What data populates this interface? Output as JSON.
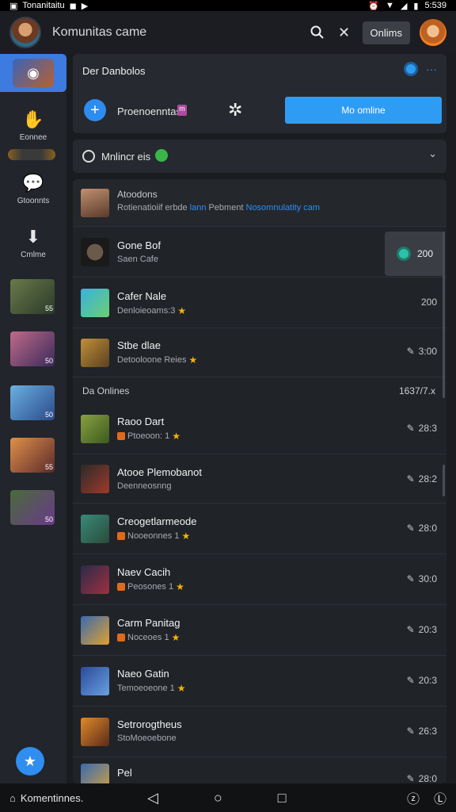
{
  "status_bar": {
    "left_text": "Tonanitaitu",
    "time": "5:539"
  },
  "app_bar": {
    "title": "Komunitas came",
    "online_button": "Onlims",
    "icons": [
      "search-icon",
      "close-icon"
    ]
  },
  "sidebar": {
    "items": [
      {
        "label": "Eonnee",
        "icon": "hand-icon"
      },
      {
        "label": "Gtoonnts",
        "icon": "chat-icon"
      },
      {
        "label": "Cmlme",
        "icon": "download-icon"
      }
    ],
    "thumb_badges": [
      "55",
      "50",
      "50",
      "55",
      "50"
    ],
    "fab_icon": "star-icon"
  },
  "header_card": {
    "title": "Der Danbolos",
    "more": "···",
    "row_label": "Proenoenntas",
    "primary_button": "Mo omline"
  },
  "filter_card": {
    "label": "Mnlincr eis"
  },
  "list": {
    "banner": {
      "title": "Atoodons",
      "subtitle": "Rotienatioiif erbde",
      "link1": "lann",
      "mid": "Pebment",
      "link2": "Nosomnulatity cam"
    },
    "featured": [
      {
        "title": "Gone Bof",
        "subtitle": "Saen Cafe",
        "value": "200",
        "highlight": true
      },
      {
        "title": "Cafer Nale",
        "subtitle": "Denloieoams:3",
        "value": "200",
        "star": true
      },
      {
        "title": "Stbe dlae",
        "subtitle": "Detooloone Reies",
        "value": "3:00",
        "star": true
      }
    ],
    "section": {
      "label": "Da Onlines",
      "count": "1637/7.x"
    },
    "games": [
      {
        "title": "Raoo Dart",
        "subtitle": "Ptoeoon: 1",
        "value": "28:3"
      },
      {
        "title": "Atooe Plemobanot",
        "subtitle": "Deenneosnng",
        "value": "28:2"
      },
      {
        "title": "Creogetlarmeode",
        "subtitle": "Nooeonnes 1",
        "value": "28:0"
      },
      {
        "title": "Naev Cacih",
        "subtitle": "Peosones 1",
        "value": "30:0"
      },
      {
        "title": "Carm Panitag",
        "subtitle": "Noceoes 1",
        "value": "20:3"
      },
      {
        "title": "Naeo Gatin",
        "subtitle": "Temoeoeone 1",
        "value": "20:3"
      },
      {
        "title": "Setrorogtheus",
        "subtitle": "StoMoeoebone",
        "value": "26:3"
      },
      {
        "title": "Pel",
        "subtitle": "",
        "value": "28:0"
      }
    ]
  },
  "nav_bar": {
    "home_label": "Komentinnes."
  }
}
